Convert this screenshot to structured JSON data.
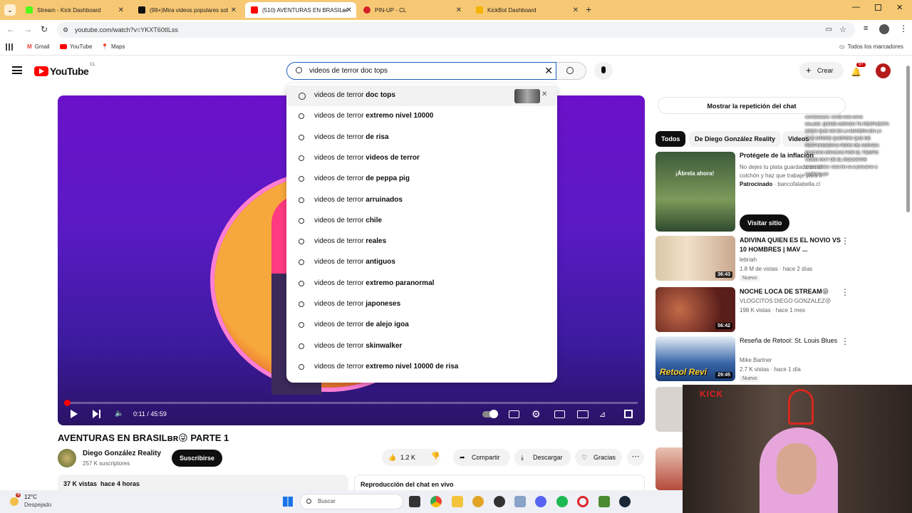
{
  "browser": {
    "tabs": [
      {
        "label": "Stream - Kick Dashboard",
        "color": "#53fc18"
      },
      {
        "label": "(99+)Mira videos populares sob",
        "color": "#111111"
      },
      {
        "label": "(510) AVENTURAS EN BRASILᴃʀ",
        "color": "#ff0000"
      },
      {
        "label": "PIN-UP - CL",
        "color": "#d4202a"
      },
      {
        "label": "KickBot Dashboard",
        "color": "#f2b400"
      }
    ],
    "url": "youtube.com/watch?v=YKXT60tILss",
    "bookmarks": [
      "Gmail",
      "YouTube",
      "Maps"
    ],
    "bookmarks_right": "Todos los marcadores"
  },
  "youtube": {
    "logo_text": "YouTube",
    "logo_country": "CL",
    "search_value": "videos de terror doc tops",
    "create_label": "Crear",
    "notif_badge": "9+",
    "suggestions": [
      {
        "prefix": "videos de terror ",
        "bold": "doc tops",
        "history": true
      },
      {
        "prefix": "videos de terror ",
        "bold": "extremo nivel 10000"
      },
      {
        "prefix": "videos de terror ",
        "bold": "de risa"
      },
      {
        "prefix": "videos de terror ",
        "bold": "videos de terror"
      },
      {
        "prefix": "videos de terror ",
        "bold": "de peppa pig"
      },
      {
        "prefix": "videos de terror ",
        "bold": "arruinados"
      },
      {
        "prefix": "videos de terror ",
        "bold": "chile"
      },
      {
        "prefix": "videos de terror ",
        "bold": "reales"
      },
      {
        "prefix": "videos de terror ",
        "bold": "antiguos"
      },
      {
        "prefix": "videos de terror ",
        "bold": "extremo paranormal"
      },
      {
        "prefix": "videos de terror ",
        "bold": "japoneses"
      },
      {
        "prefix": "videos de terror ",
        "bold": "de alejo igoa"
      },
      {
        "prefix": "videos de terror ",
        "bold": "skinwalker"
      },
      {
        "prefix": "videos de terror ",
        "bold": "extremo nivel 10000 de risa"
      }
    ],
    "player": {
      "time": "0:11 / 45:59",
      "progress": 0.004
    },
    "video": {
      "title": "AVENTURAS EN BRASILʙʀ😜 PARTE 1",
      "channel": "Diego González Reality",
      "subs": "257 K suscriptores",
      "subscribe": "Suscribirse",
      "likes": "1.2 K",
      "share": "Compartir",
      "download": "Descargar",
      "thanks": "Gracias",
      "views_line": "37 K vistas  hace 4 horas",
      "chat_replay": "Reproducción del chat en vivo"
    },
    "sidebar": {
      "chat_button": "Mostrar la repetición del chat",
      "chips": [
        "Todos",
        "De Diego González Reality",
        "Videos"
      ],
      "ad": {
        "title": "Protégete de la inflación",
        "desc": "No dejes tu plata guardada en el colchón y haz que trabaje para ti",
        "sponsored": "Patrocinado",
        "advertiser": "bancofalabella.cl",
        "cta": "Visitar sitio",
        "thumb_text": "¡Ábrela ahora!"
      },
      "videos": [
        {
          "title": "ADIVINA QUIEN ES EL NOVIO VS 10 HOMBRES | MAV ...",
          "channel": "lebriah",
          "meta": "1.8 M de vistas · hace 2 días",
          "duration": "36:43",
          "badge": "Nuevo"
        },
        {
          "title": "NOCHE LOCA DE STREAM😜",
          "channel": "VLOGCITOS DIEGO GONZALEZ😜",
          "meta": "198 K vistas · hace 1 mes",
          "duration": "56:42",
          "badge": ""
        },
        {
          "title": "Reseña de Retool: St. Louis Blues",
          "channel": "Mike Bartner",
          "meta": "2.7 K vistas · hace 1 día",
          "duration": "29:45",
          "badge": "Nuevo",
          "thumb_text": "Retool Revi"
        }
      ]
    },
    "stream_overlay": [
      "constanzaxx: verdá esta weno",
      "leku183: @CMD AGRADA TU RESPUESTA CREO QUE NO ES LA MANERA EN LA QUE DIRESE QUERIDO QUE ME RESPONDIERAS PERO ME AGRADA MUCHAS GRACIAS POR EL TIEMPO VOMG MUY DE EL ROCKSTAR",
      "ivansantolas: esta kio va a pescarse a conlleras.po"
    ]
  },
  "webcam": {
    "brand": "KICK"
  },
  "taskbar": {
    "weather_temp": "12°C",
    "weather_desc": "Despejado",
    "weather_badge": "4",
    "search_placeholder": "Buscar"
  }
}
